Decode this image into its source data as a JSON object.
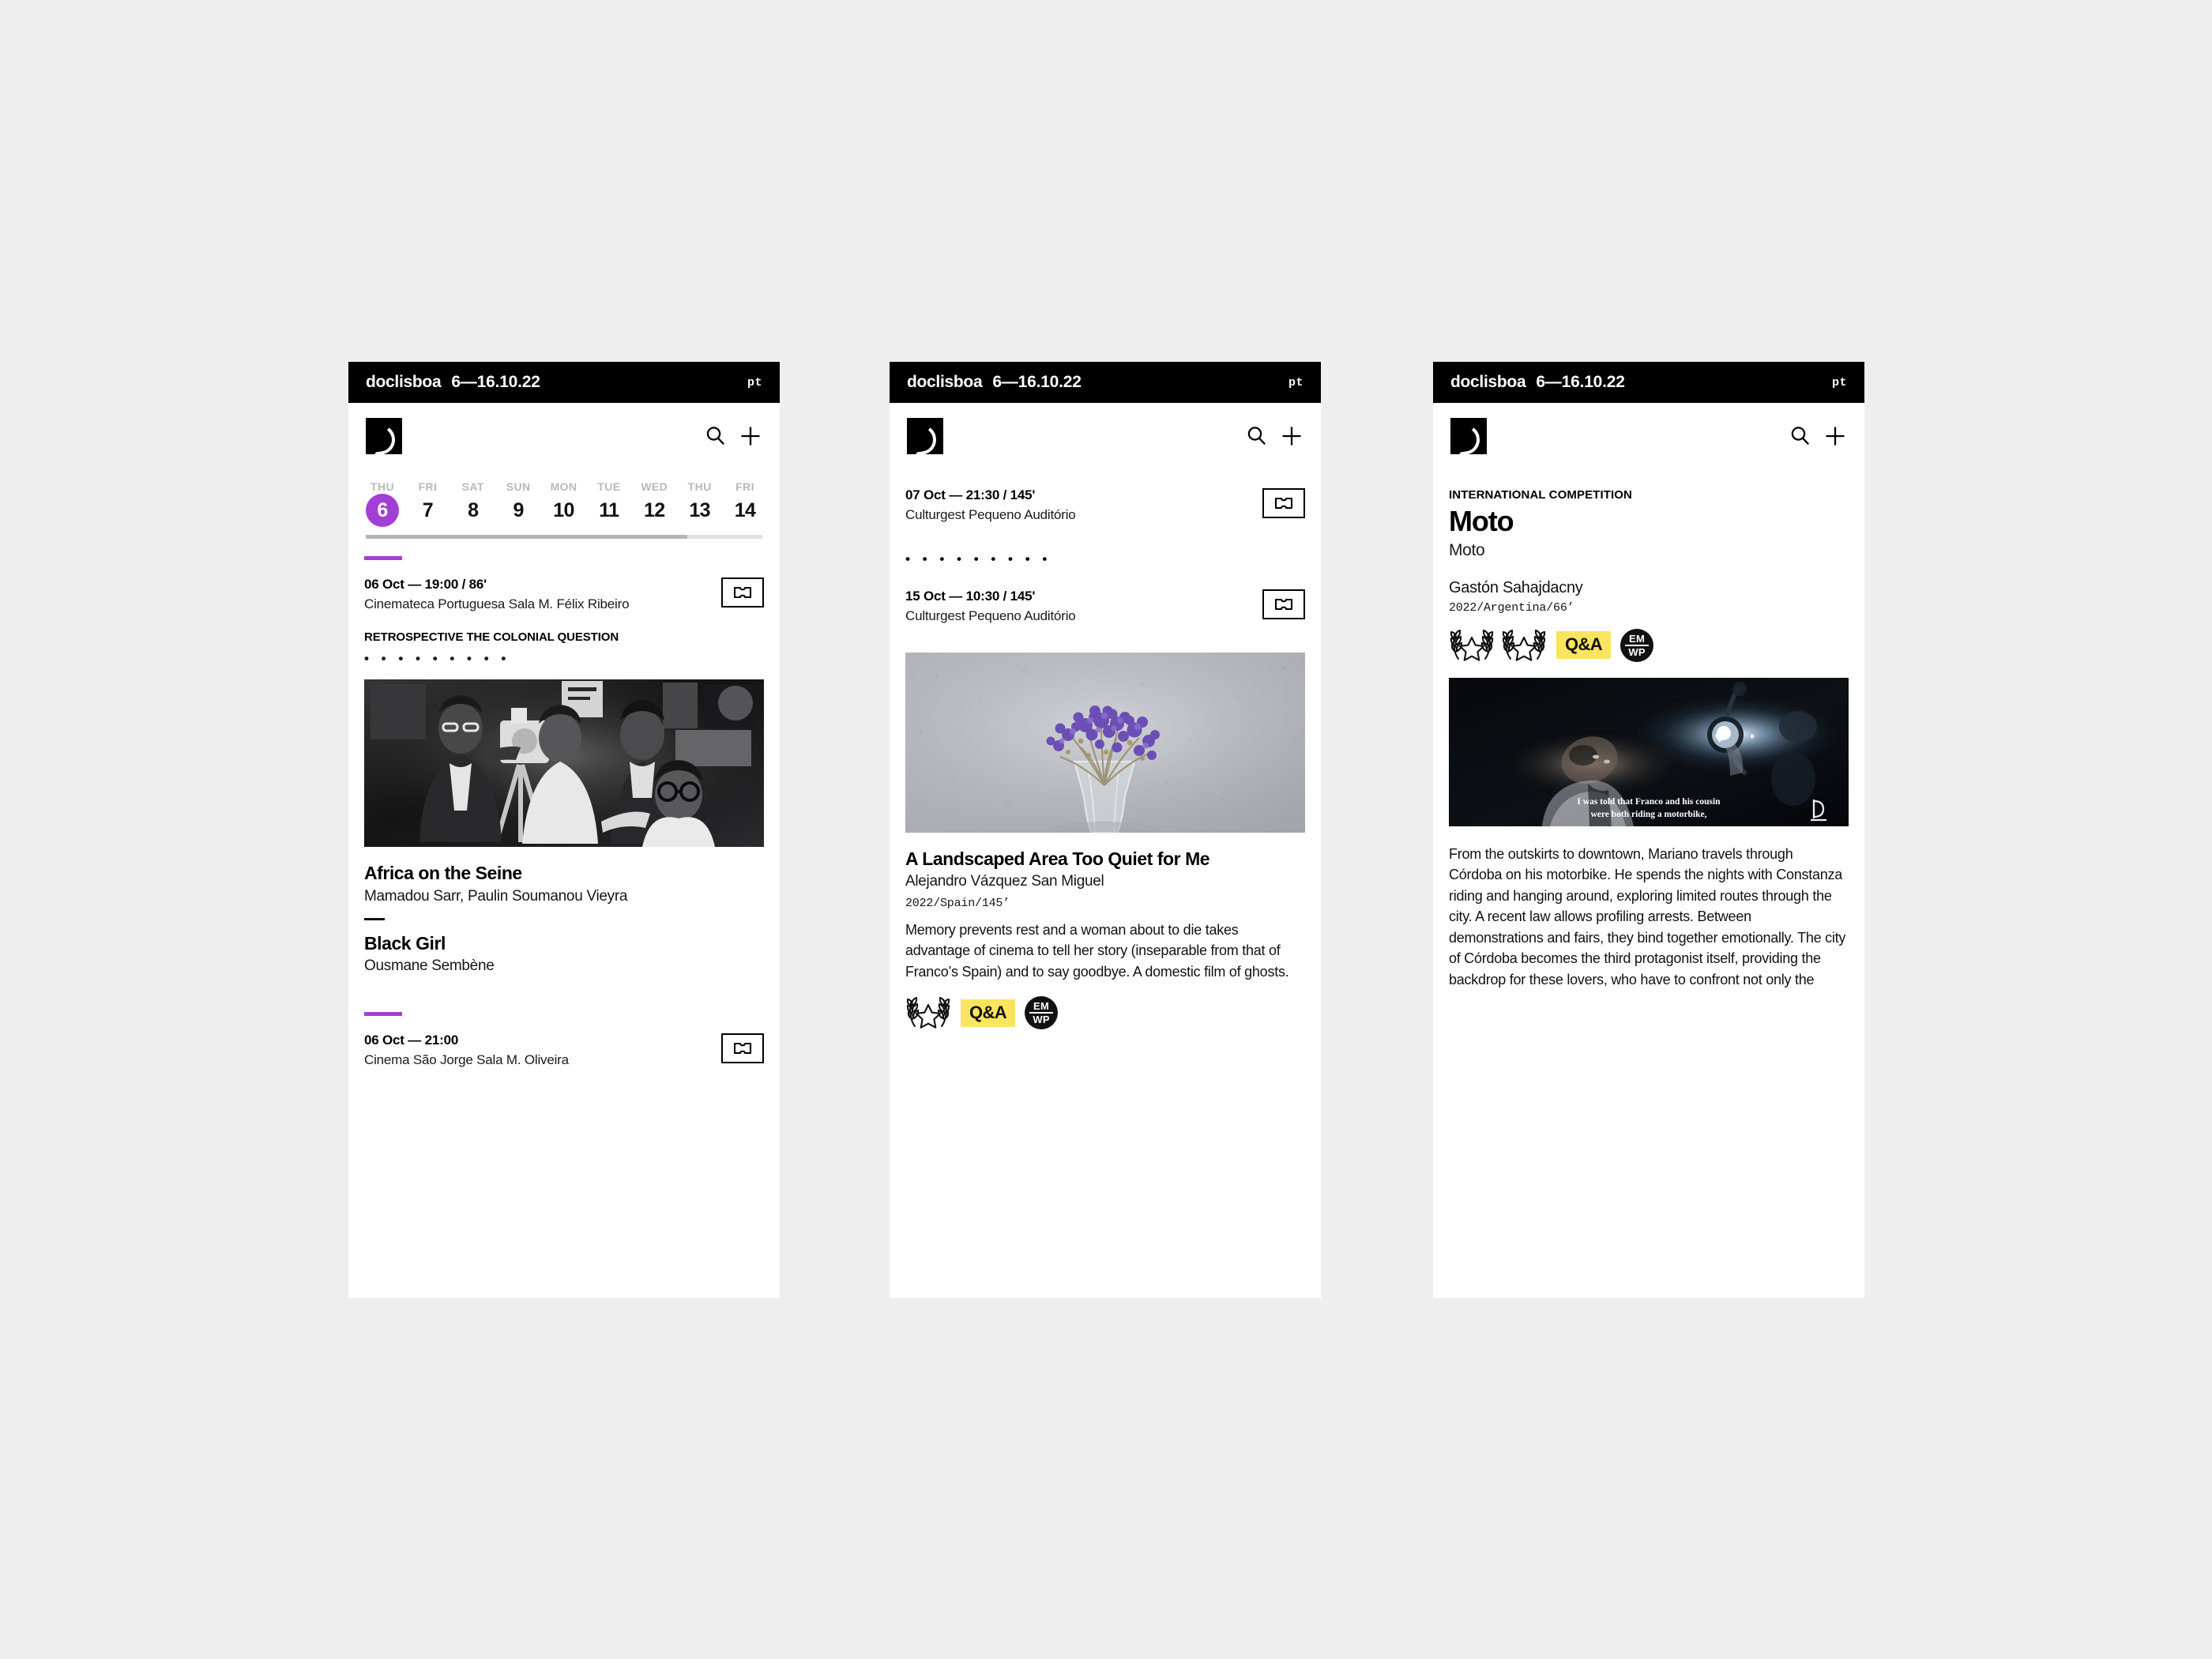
{
  "header": {
    "brand": "doclisboa",
    "dates": "6—16.10.22",
    "lang": "pt",
    "logo_icon": "crescent-moon-logo",
    "search_icon": "search-icon",
    "add_icon": "plus-icon"
  },
  "calendar": {
    "days": [
      {
        "dow": "THU",
        "num": "6",
        "active": true
      },
      {
        "dow": "FRI",
        "num": "7",
        "active": false
      },
      {
        "dow": "SAT",
        "num": "8",
        "active": false
      },
      {
        "dow": "SUN",
        "num": "9",
        "active": false
      },
      {
        "dow": "MON",
        "num": "10",
        "active": false
      },
      {
        "dow": "TUE",
        "num": "11",
        "active": false
      },
      {
        "dow": "WED",
        "num": "12",
        "active": false
      },
      {
        "dow": "THU",
        "num": "13",
        "active": false
      },
      {
        "dow": "FRI",
        "num": "14",
        "active": false
      }
    ],
    "accent_color": "#a13fd6"
  },
  "screen1": {
    "session_top": {
      "when": "06 Oct — 19:00 / 86'",
      "where": "Cinemateca Portuguesa Sala M. Félix Ribeiro",
      "ticket_icon": "ticket-icon"
    },
    "section_tag": "RETROSPECTIVE THE COLONIAL QUESTION",
    "dots": "• • • • • • • • •",
    "photo_alt": "black-and-white photo of film crew with a camera on a tripod",
    "films": [
      {
        "title": "Africa on the Seine",
        "director": "Mamadou Sarr, Paulin Soumanou Vieyra"
      },
      {
        "title": "Black Girl",
        "director": "Ousmane Sembène"
      }
    ],
    "session_bottom": {
      "when": "06 Oct — 21:00",
      "where": "Cinema São Jorge Sala M. Oliveira",
      "ticket_icon": "ticket-icon"
    }
  },
  "screen2": {
    "sessions": [
      {
        "when": "07 Oct — 21:30 / 145'",
        "where": "Culturgest Pequeno Auditório",
        "ticket_icon": "ticket-icon"
      },
      {
        "when": "15 Oct — 10:30 / 145'",
        "where": "Culturgest Pequeno Auditório",
        "ticket_icon": "ticket-icon"
      }
    ],
    "dots": "• • • • • • • • •",
    "photo_alt": "dried purple statice flowers in a glass vase against a textured wall",
    "film": {
      "title": "A Landscaped Area Too Quiet for Me",
      "director": "Alejandro Vázquez San Miguel",
      "meta": "2022/Spain/145’",
      "synopsis": "Memory prevents rest and a woman about to die takes advantage of cinema to tell her story (inseparable from that of Franco’s Spain) and to say goodbye. A domestic film of ghosts."
    },
    "badges": {
      "laurel_count": 1,
      "laurel_icon": "laurel-star-icon",
      "qa_label": "Q&A",
      "emwp_top": "EM",
      "emwp_bottom": "WP",
      "qa_color": "#fbe45f"
    }
  },
  "screen3": {
    "kicker": "INTERNATIONAL COMPETITION",
    "title": "Moto",
    "original_title": "Moto",
    "director": "Gastón Sahajdacny",
    "meta": "2022/Argentina/66’",
    "badges": {
      "laurel_count": 2,
      "laurel_icon": "laurel-star-icon",
      "qa_label": "Q&A",
      "emwp_top": "EM",
      "emwp_bottom": "WP",
      "qa_color": "#fbe45f"
    },
    "still": {
      "alt": "dark film still of a man lying beside a motorbike headlight",
      "subtitle_line1": "I was told that Franco and his cousin",
      "subtitle_line2": "were both riding a motorbike,",
      "watermark_icon": "doclisboa-watermark-icon"
    },
    "synopsis": "From the outskirts to downtown, Mariano travels through Córdoba on his motorbike. He spends the nights with Constanza riding and hanging around, exploring limited routes through the city. A recent law allows profiling arrests. Between demonstrations and fairs, they bind together emotionally. The city of Córdoba becomes the third protagonist itself, providing the backdrop for these lovers, who have to confront not only the"
  }
}
